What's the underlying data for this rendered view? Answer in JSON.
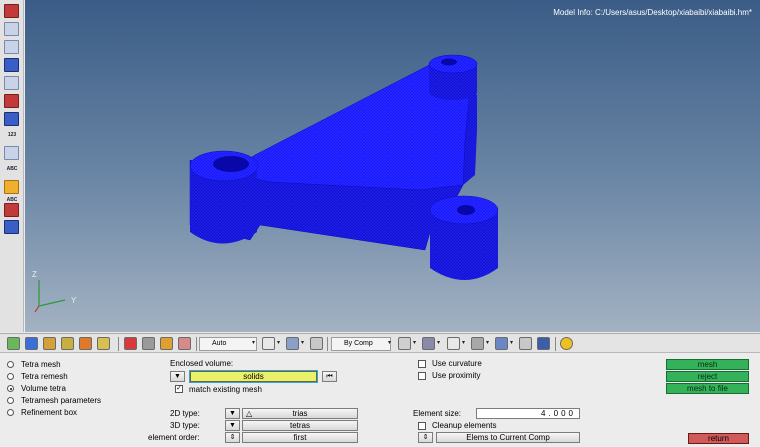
{
  "viewport": {
    "model_info": "Model Info: C:/Users/asus/Desktop/xiabaibi/xiabaibi.hm*",
    "axis_z": "Z",
    "axis_y": "Y"
  },
  "left_toolbar": {
    "labels": [
      "123",
      "ABC",
      "ABC"
    ]
  },
  "toolbar": {
    "auto_label": "Auto",
    "by_comp_label": "By Comp"
  },
  "panel": {
    "mesh_types": [
      {
        "label": "Tetra mesh",
        "checked": false
      },
      {
        "label": "Tetra remesh",
        "checked": false
      },
      {
        "label": "Volume tetra",
        "checked": true
      },
      {
        "label": "Tetramesh parameters",
        "checked": false
      },
      {
        "label": "Refinement box",
        "checked": false
      }
    ],
    "enclosed_volume_label": "Enclosed volume:",
    "solids_label": "solids",
    "match_existing_mesh_label": "match existing mesh",
    "use_curvature_label": "Use curvature",
    "use_proximity_label": "Use proximity",
    "type_2d_label": "2D type:",
    "type_2d_value": "trias",
    "type_3d_label": "3D type:",
    "type_3d_value": "tetras",
    "element_order_label": "element order:",
    "element_order_value": "first",
    "element_size_label": "Element size:",
    "element_size_value": "4.000",
    "cleanup_elements_label": "Cleanup elements",
    "elems_to_current_comp_label": "Elems to Current Comp",
    "mesh_label": "mesh",
    "reject_label": "reject",
    "mesh_to_file_label": "mesh to file",
    "return_label": "return"
  },
  "colors": {
    "mesh_blue": "#1a1aff",
    "accept_green": "#33b25a",
    "return_red": "#d05a5a",
    "active_field_yellow": "#e9f06a"
  }
}
